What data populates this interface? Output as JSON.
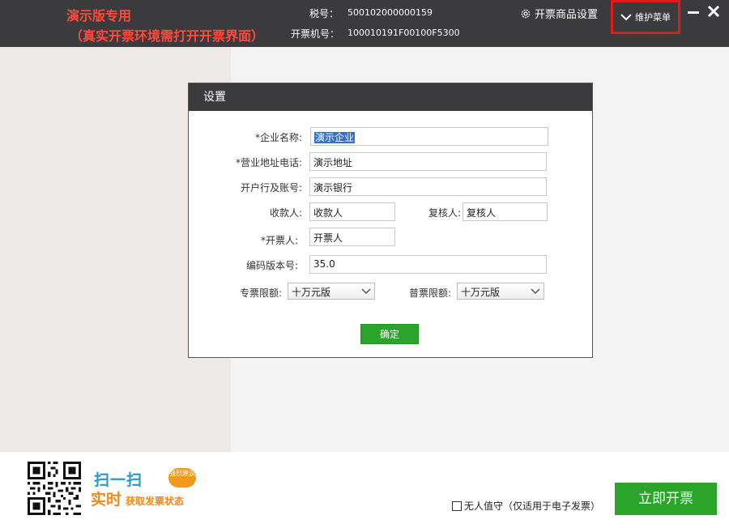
{
  "topbar": {
    "demo_line1": "演示版专用",
    "demo_line2": "（真实开票环境需打开开票界面）",
    "tax_no_label": "税号：",
    "tax_no_value": "500102000000159",
    "machine_no_label": "开票机号：",
    "machine_no_value": "100010191F00100F5300",
    "goods_settings_label": "开票商品设置",
    "maintenance_menu_label": "维护菜单",
    "icons": {
      "settings": "gear-icon",
      "menu": "chevron-down-icon",
      "minimize": "minimize-icon",
      "close": "close-icon"
    },
    "colors": {
      "bar_bg": "#3b3b3d",
      "demo_text": "#ff4a3d",
      "highlight_border": "#e01b1b"
    }
  },
  "dialog": {
    "title": "设置",
    "fields": {
      "company_name_label": "*企业名称:",
      "company_name_value": "演示企业",
      "address_phone_label": "*营业地址电话:",
      "address_phone_value": "演示地址",
      "bank_account_label": "开户行及账号:",
      "bank_account_value": "演示银行",
      "payee_label": "收款人:",
      "payee_value": "收款人",
      "reviewer_label": "复核人:",
      "reviewer_value": "复核人",
      "issuer_label": "*开票人:",
      "issuer_value": "开票人",
      "code_version_label": "编码版本号:",
      "code_version_value": "35.0",
      "special_limit_label": "专票限额:",
      "special_limit_value": "十万元版",
      "normal_limit_label": "普票限额:",
      "normal_limit_value": "十万元版"
    },
    "confirm_label": "确定"
  },
  "footer": {
    "promo_scan": "扫一扫",
    "promo_bubble": "强烈建议",
    "promo_realtime": "实时",
    "promo_sub": "获取发票状态",
    "unattended_label": "无人值守（仅适用于电子发票）",
    "unattended_checked": false,
    "issue_now_label": "立即开票",
    "colors": {
      "issue_button": "#2aa52a",
      "promo_blue": "#1e9bd7",
      "promo_orange": "#ef8a1b"
    }
  }
}
